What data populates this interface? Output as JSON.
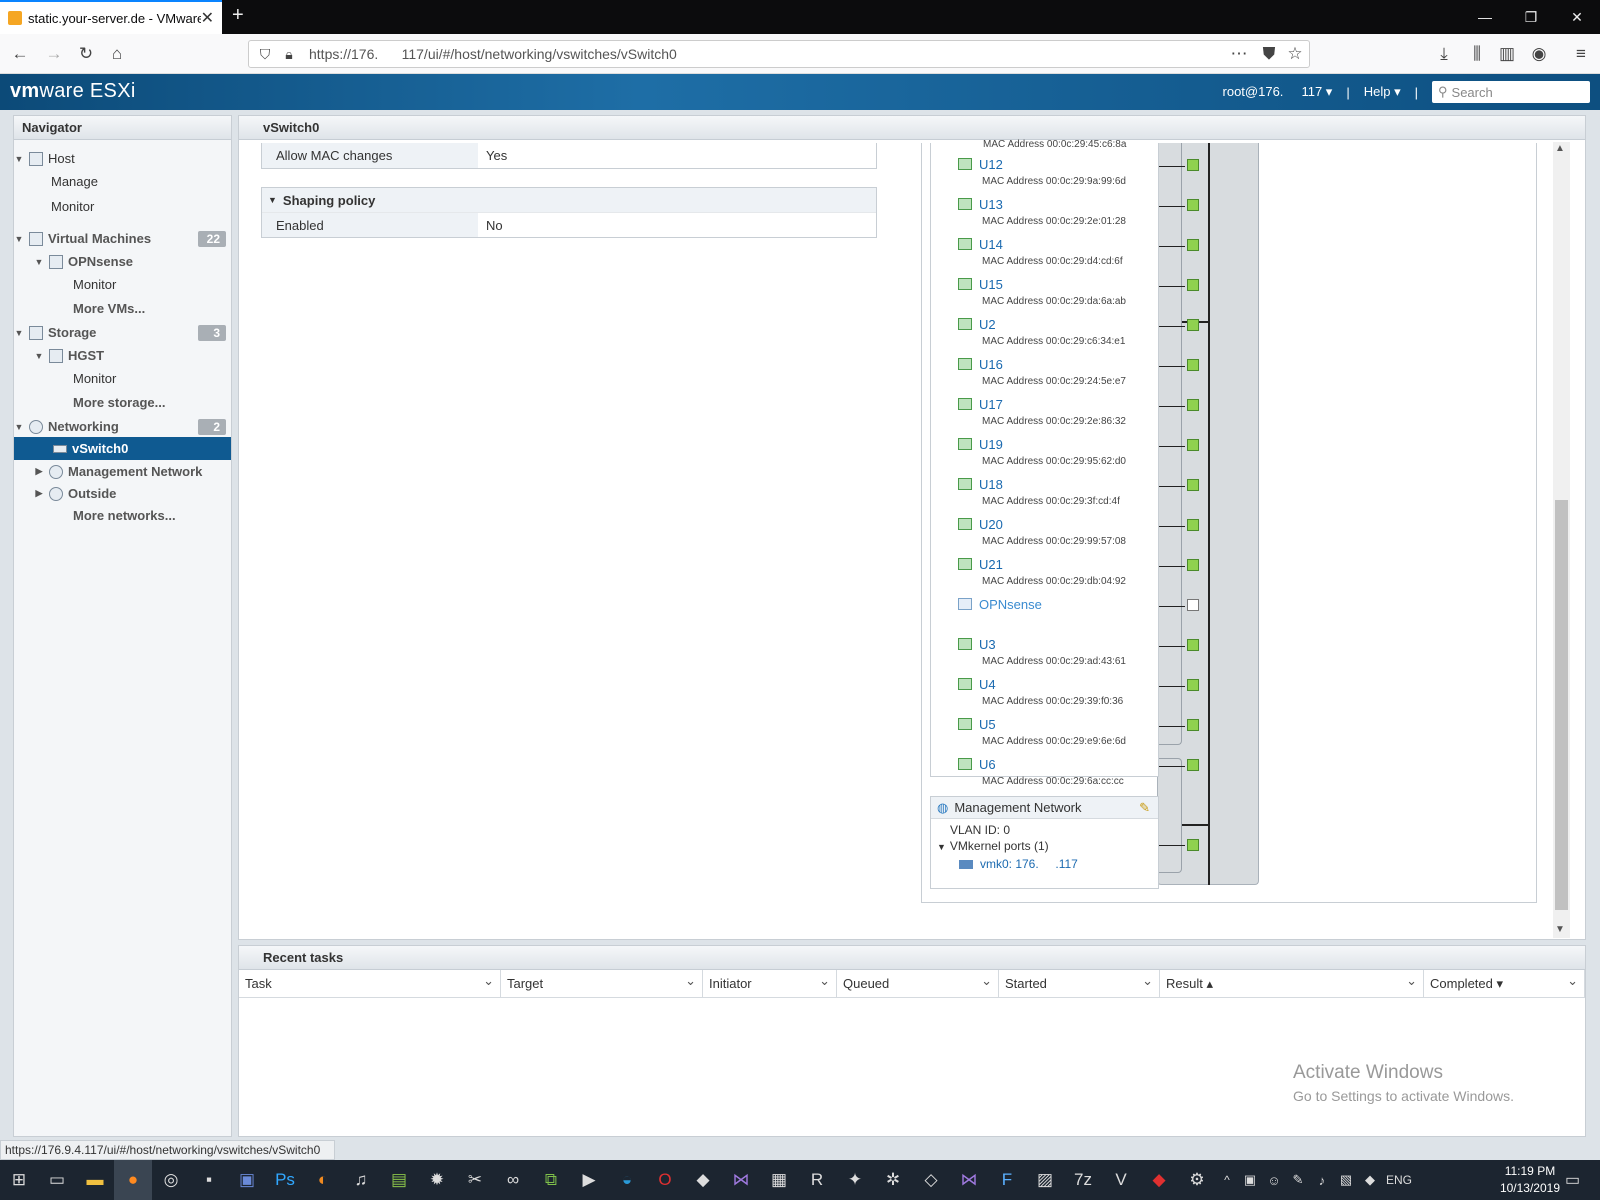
{
  "browser": {
    "tab_title": "static.your-server.de - VMware",
    "url": "https://176.      117/ui/#/host/networking/vswitches/vSwitch0",
    "status_url": "https://176.9.4.117/ui/#/host/networking/vswitches/vSwitch0"
  },
  "header": {
    "logo_main": "vm",
    "logo_rest": "ware ESXi",
    "user": "root@176.     117 ▾",
    "help": "Help ▾",
    "search_placeholder": "Search"
  },
  "navigator": {
    "title": "Navigator",
    "host": "Host",
    "manage": "Manage",
    "monitor": "Monitor",
    "vms": "Virtual Machines",
    "vms_count": "22",
    "opnsense": "OPNsense",
    "opn_monitor": "Monitor",
    "more_vms": "More VMs...",
    "storage": "Storage",
    "storage_count": "3",
    "hgst": "HGST",
    "hgst_monitor": "Monitor",
    "more_storage": "More storage...",
    "networking": "Networking",
    "net_count": "2",
    "vswitch0": "vSwitch0",
    "mgmt": "Management Network",
    "outside": "Outside",
    "more_networks": "More networks..."
  },
  "main": {
    "title": "vSwitch0",
    "allow_mac_k": "Allow MAC changes",
    "allow_mac_v": "Yes",
    "shaping": "Shaping policy",
    "enabled_k": "Enabled",
    "enabled_v": "No",
    "top_mac": "MAC Address 00:0c:29:45:c6:8a",
    "vms": [
      {
        "name": "U12",
        "mac": "MAC Address 00:0c:29:9a:99:6d"
      },
      {
        "name": "U13",
        "mac": "MAC Address 00:0c:29:2e:01:28"
      },
      {
        "name": "U14",
        "mac": "MAC Address 00:0c:29:d4:cd:6f"
      },
      {
        "name": "U15",
        "mac": "MAC Address 00:0c:29:da:6a:ab"
      },
      {
        "name": "U2",
        "mac": "MAC Address 00:0c:29:c6:34:e1"
      },
      {
        "name": "U16",
        "mac": "MAC Address 00:0c:29:24:5e:e7"
      },
      {
        "name": "U17",
        "mac": "MAC Address 00:0c:29:2e:86:32"
      },
      {
        "name": "U19",
        "mac": "MAC Address 00:0c:29:95:62:d0"
      },
      {
        "name": "U18",
        "mac": "MAC Address 00:0c:29:3f:cd:4f"
      },
      {
        "name": "U20",
        "mac": "MAC Address 00:0c:29:99:57:08"
      },
      {
        "name": "U21",
        "mac": "MAC Address 00:0c:29:db:04:92"
      },
      {
        "name": "OPNsense",
        "mac": ""
      },
      {
        "name": "U3",
        "mac": "MAC Address 00:0c:29:ad:43:61"
      },
      {
        "name": "U4",
        "mac": "MAC Address 00:0c:29:39:f0:36"
      },
      {
        "name": "U5",
        "mac": "MAC Address 00:0c:29:e9:6e:6d"
      },
      {
        "name": "U6",
        "mac": "MAC Address 00:0c:29:6a:cc:cc"
      }
    ],
    "mgmt_title": "Management Network",
    "vlan": "VLAN ID: 0",
    "vmk_ports": "VMkernel ports (1)",
    "vmk0": "vmk0: 176.     .117"
  },
  "tasks": {
    "title": "Recent tasks",
    "columns": [
      "Task",
      "Target",
      "Initiator",
      "Queued",
      "Started",
      "Result ▴",
      "Completed ▾"
    ]
  },
  "watermark": {
    "line1": "Activate Windows",
    "line2": "Go to Settings to activate Windows."
  },
  "clock": {
    "time": "11:19 PM",
    "date": "10/13/2019",
    "lang": "ENG"
  }
}
